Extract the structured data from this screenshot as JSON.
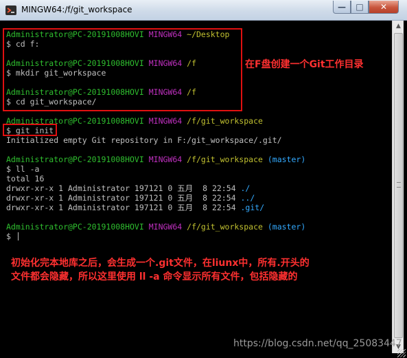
{
  "window": {
    "title": "MINGW64:/f/git_workspace",
    "minimize_glyph": "—",
    "maximize_glyph": "□",
    "close_glyph": "✕",
    "icon_name": "git-bash-icon"
  },
  "terminal": {
    "lines": [
      {
        "user": "Administrator@PC-20191008HOVI",
        "shell": "MINGW64",
        "path": "~/Desktop",
        "branch": ""
      },
      {
        "cmd": "$ cd f:"
      },
      {
        "blank": true
      },
      {
        "user": "Administrator@PC-20191008HOVI",
        "shell": "MINGW64",
        "path": "/f",
        "branch": ""
      },
      {
        "cmd": "$ mkdir git_workspace"
      },
      {
        "blank": true
      },
      {
        "user": "Administrator@PC-20191008HOVI",
        "shell": "MINGW64",
        "path": "/f",
        "branch": ""
      },
      {
        "cmd": "$ cd git_workspace/"
      },
      {
        "blank": true
      },
      {
        "user": "Administrator@PC-20191008HOVI",
        "shell": "MINGW64",
        "path": "/f/git_workspace",
        "branch": ""
      },
      {
        "cmd": "$ git init"
      },
      {
        "out": "Initialized empty Git repository in F:/git_workspace/.git/"
      },
      {
        "blank": true
      },
      {
        "user": "Administrator@PC-20191008HOVI",
        "shell": "MINGW64",
        "path": "/f/git_workspace",
        "branch": "(master)"
      },
      {
        "cmd": "$ ll -a"
      },
      {
        "out": "total 16"
      },
      {
        "out": "drwxr-xr-x 1 Administrator 197121 0 五月  8 22:54 ",
        "tail": "./"
      },
      {
        "out": "drwxr-xr-x 1 Administrator 197121 0 五月  8 22:54 ",
        "tail": "../"
      },
      {
        "out": "drwxr-xr-x 1 Administrator 197121 0 五月  8 22:54 ",
        "tail": ".git/"
      },
      {
        "blank": true
      },
      {
        "user": "Administrator@PC-20191008HOVI",
        "shell": "MINGW64",
        "path": "/f/git_workspace",
        "branch": "(master)"
      },
      {
        "cmd": "$ ",
        "cursor": true
      }
    ]
  },
  "annotations": {
    "note_top": "在F盘创建一个Git工作目录",
    "note_bottom_line1": "初始化完本地库之后，会生成一个.git文件，在liunx中，所有.开头的",
    "note_bottom_line2": "文件都会隐藏，所以这里使用 ll -a 命令显示所有文件，包括隐藏的",
    "color": "#ff3030"
  },
  "scrollbar": {
    "up_glyph": "▲",
    "down_glyph": "▼"
  },
  "watermark": "https://blog.csdn.net/qq_25083447"
}
